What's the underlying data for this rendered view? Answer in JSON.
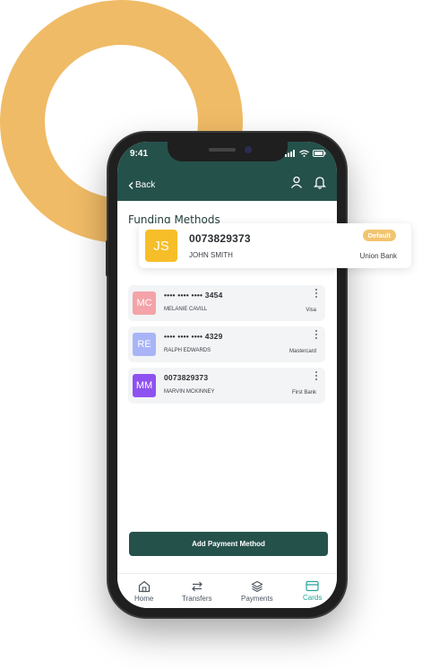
{
  "status_bar": {
    "time": "9:41"
  },
  "header": {
    "back_label": "Back"
  },
  "section": {
    "title": "Funding Methods"
  },
  "featured_method": {
    "initials": "JS",
    "number": "0073829373",
    "holder": "JOHN SMITH",
    "bank": "Union Bank",
    "badge": "Default",
    "avatar_color": "#F6BE28"
  },
  "methods": [
    {
      "initials": "MC",
      "number": "•••• •••• •••• 3454",
      "holder": "MELANIE CAVILL",
      "bank": "Visa",
      "avatar_color": "#F4A3A8"
    },
    {
      "initials": "RE",
      "number": "•••• •••• •••• 4329",
      "holder": "RALPH EDWARDS",
      "bank": "Mastercard",
      "avatar_color": "#A9B4F6"
    },
    {
      "initials": "MM",
      "number": "0073829373",
      "holder": "MARVIN MCKINNEY",
      "bank": "First Bank",
      "avatar_color": "#8E52F1"
    }
  ],
  "actions": {
    "add_label": "Add Payment Method"
  },
  "nav": [
    {
      "label": "Home",
      "icon": "home-icon"
    },
    {
      "label": "Transfers",
      "icon": "transfer-icon"
    },
    {
      "label": "Payments",
      "icon": "layers-icon"
    },
    {
      "label": "Cards",
      "icon": "card-icon",
      "active": true
    }
  ],
  "colors": {
    "brand": "#25514B",
    "accent": "#27A29A",
    "ring": "#F0BB66",
    "badge": "#F2C46F"
  }
}
